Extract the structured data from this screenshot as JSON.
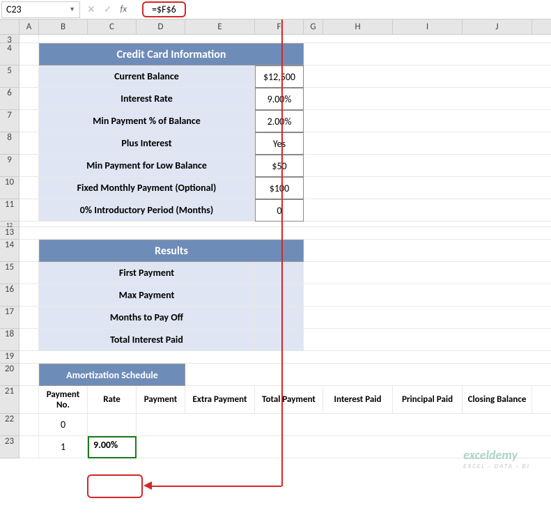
{
  "formula_bar": {
    "cell_ref": "C23",
    "formula": "=$F$6"
  },
  "columns": [
    "",
    "A",
    "B",
    "C",
    "D",
    "E",
    "F",
    "G",
    "H",
    "I",
    "J"
  ],
  "rows": [
    "3",
    "4",
    "5",
    "6",
    "7",
    "8",
    "9",
    "10",
    "11",
    "12",
    "13",
    "14",
    "15",
    "16",
    "17",
    "18",
    "19",
    "20",
    "21",
    "22",
    "23"
  ],
  "section1_title": "Credit Card Information",
  "info_rows": [
    {
      "label": "Current Balance",
      "value": "$12,500"
    },
    {
      "label": "Interest Rate",
      "value": "9.00%"
    },
    {
      "label": "Min Payment % of Balance",
      "value": "2.00%"
    },
    {
      "label": "Plus Interest",
      "value": "Yes"
    },
    {
      "label": "Min Payment for Low Balance",
      "value": "$50"
    },
    {
      "label": "Fixed Monthly Payment (Optional)",
      "value": "$100"
    },
    {
      "label": "0% Introductory Period (Months)",
      "value": "0"
    }
  ],
  "section2_title": "Results",
  "results_rows": [
    {
      "label": "First Payment",
      "value": ""
    },
    {
      "label": "Max Payment",
      "value": ""
    },
    {
      "label": "Months to Pay Off",
      "value": ""
    },
    {
      "label": "Total Interest Paid",
      "value": ""
    }
  ],
  "section3_title": "Amortization Schedule",
  "amort_headers": [
    "Payment No.",
    "Rate",
    "Payment",
    "Extra Payment",
    "Total Payment",
    "Interest Paid",
    "Principal Paid",
    "Closing Balance"
  ],
  "amort_rows": [
    {
      "no": "0",
      "rate": "",
      "payment": ""
    },
    {
      "no": "1",
      "rate": "9.00%",
      "payment": ""
    }
  ],
  "watermark": {
    "main": "exceldemy",
    "sub": "EXCEL · DATA · BI"
  }
}
